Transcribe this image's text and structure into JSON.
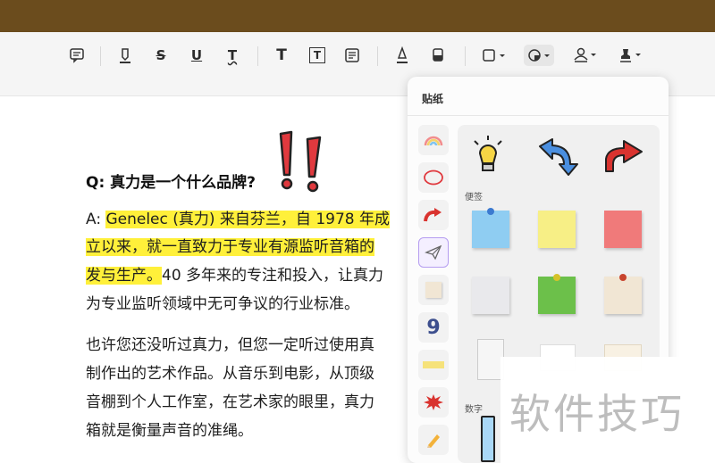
{
  "toolbar": {
    "tools": [
      "note",
      "highlight",
      "strikethrough",
      "underline",
      "squiggly",
      "text",
      "text-box",
      "text-callout",
      "pen",
      "eraser",
      "shape",
      "sticker",
      "signature",
      "stamp"
    ],
    "strike_label": "S",
    "underline_label": "U",
    "squiggly_label": "T",
    "text_label": "T",
    "textbox_label": "T"
  },
  "document": {
    "question": "Q: 真力是一个什么品牌?",
    "line1_prefix": "A: ",
    "line1_highlight": "Genelec (真力) 来自芬兰，自 1978 年成",
    "line2_highlight": "立以来，就一直致力于专业有源监听音箱的",
    "line3_highlight": "发与生产。",
    "line3_rest": "40 多年来的专注和投入，让真力",
    "line4": "为专业监听领域中无可争议的行业标准。",
    "line5": "也许您还没听过真力，但您一定听过使用真",
    "line6": "制作出的艺术作品。从音乐到电影，从顶级",
    "line7": "音棚到个人工作室，在艺术家的眼里，真力",
    "line8": "箱就是衡量声音的准绳。"
  },
  "sticker_panel": {
    "title": "贴纸",
    "section_notes": "便签",
    "section_numbers": "数字",
    "categories": [
      "rainbow-icon",
      "circle-icon",
      "arrow-icon",
      "paper-plane-icon",
      "note-icon",
      "number-nine-icon",
      "tape-icon",
      "burst-icon",
      "pencil-icon"
    ],
    "number_nine_glyph": "9"
  },
  "watermark": "软件技巧",
  "colors": {
    "top_bar": "#6b4c1d",
    "highlight": "#fff03a",
    "exclamation": "#e0393e",
    "accent_purple": "#b59df0"
  }
}
